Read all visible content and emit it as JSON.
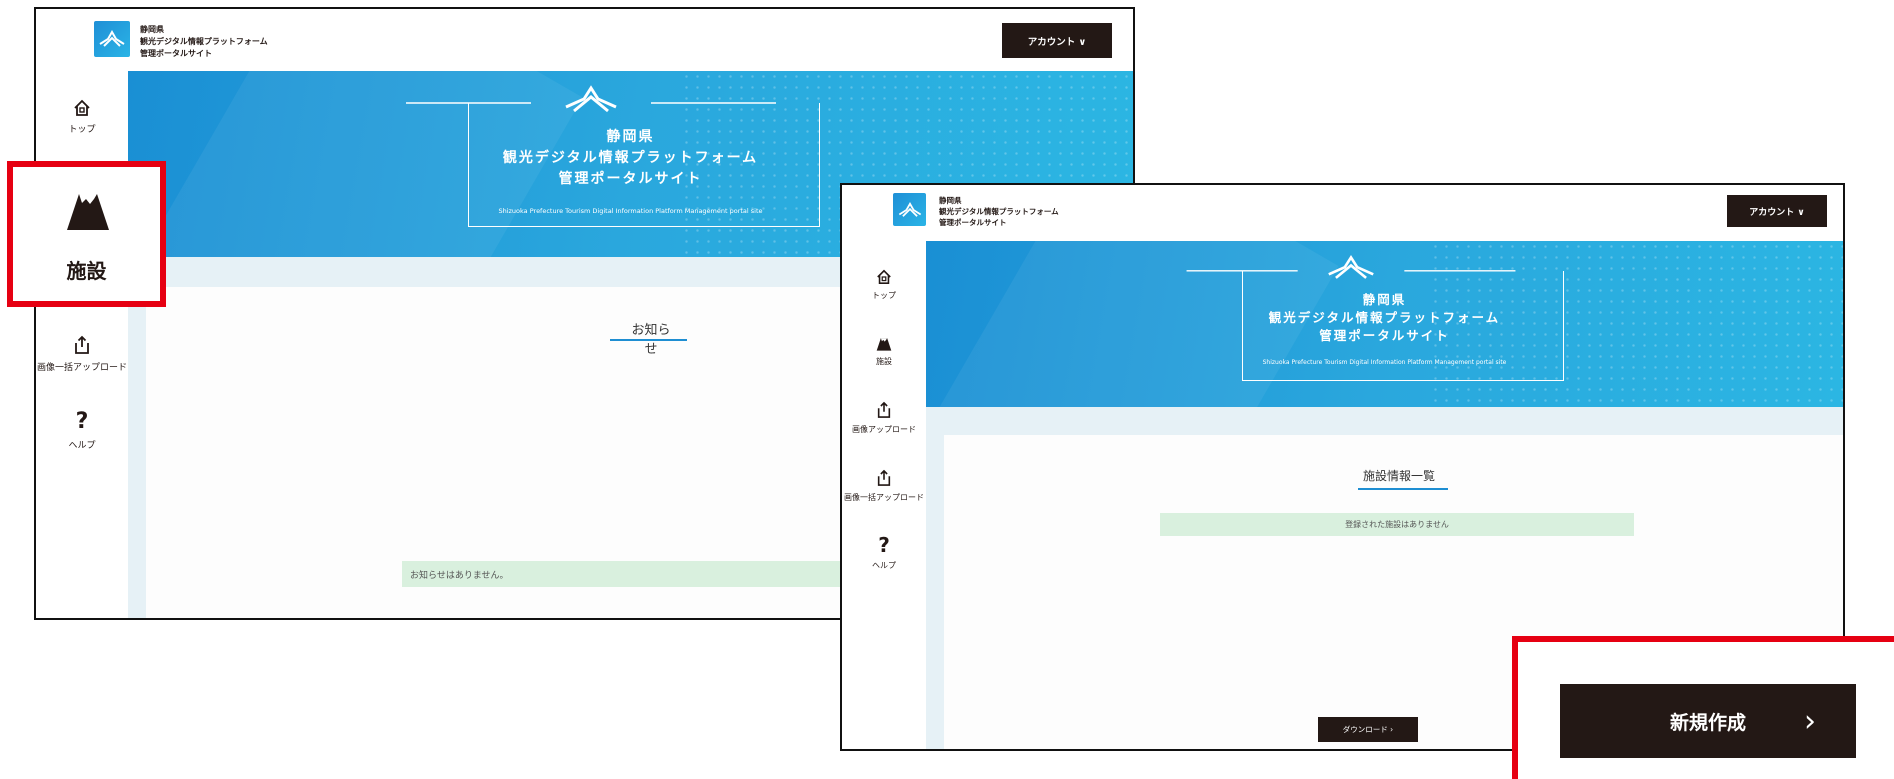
{
  "org": {
    "line1": "静岡県",
    "line2": "観光デジタル情報プラットフォーム",
    "line3": "管理ポータルサイト"
  },
  "account_label": "アカウント ∨",
  "hero": {
    "line1": "静岡県",
    "line2": "観光デジタル情報プラットフォーム",
    "line3": "管理ポータルサイト",
    "english": "Shizuoka Prefecture Tourism Digital Information Platform Management portal site"
  },
  "screen1": {
    "nav": {
      "top": "トップ",
      "facility": "施設",
      "bulk_upload": "画像一括アップロード",
      "help": "ヘルプ",
      "help_glyph": "?"
    },
    "panel_title": "お知らせ",
    "notice": "お知らせはありません。"
  },
  "screen2": {
    "nav": {
      "top": "トップ",
      "facility": "施設",
      "image_upload": "画像アップロード",
      "bulk_upload": "画像一括アップロード",
      "help": "ヘルプ",
      "help_glyph": "?"
    },
    "panel_title": "施設情報一覧",
    "empty_message": "登録された施設はありません",
    "download_label": "ダウンロード ›"
  },
  "callouts": {
    "facility_label": "施設",
    "new_button_label": "新規作成",
    "new_button_arrow": "›"
  },
  "colors": {
    "dark": "#231815",
    "brand_blue": "#1e8ed2",
    "highlight_red": "#e60012",
    "notice_green": "#d9f0de"
  }
}
